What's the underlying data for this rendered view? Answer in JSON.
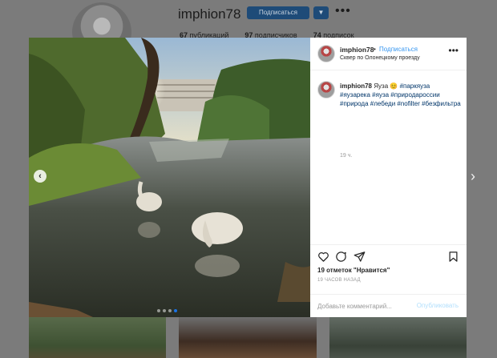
{
  "profile": {
    "username": "imphion78",
    "follow_label": "Подписаться",
    "dropdown_icon": "chevron-down-icon",
    "more_icon": "more-horizontal-icon",
    "stats": [
      {
        "count": "67",
        "label": "публикаций"
      },
      {
        "count": "97",
        "label": "подписчиков"
      },
      {
        "count": "74",
        "label": "подписок"
      }
    ]
  },
  "post": {
    "header": {
      "username": "imphion78",
      "separator": "•",
      "follow_label": "Подписаться",
      "location": "Сквер по Олонецкому проезду"
    },
    "caption": {
      "username": "imphion78",
      "text": "Яуза 😊",
      "hashtags": [
        "#паркяуза",
        "#яузарека",
        "#яуза",
        "#природароссии",
        "#природа",
        "#лебеди",
        "#nofilter",
        "#безфильтра"
      ]
    },
    "caption_time": "19 ч.",
    "likes": "19 отметок \"Нравится\"",
    "posted_ago": "19 ЧАСОВ НАЗАД",
    "comment_placeholder": "Добавьте комментарий...",
    "publish_label": "Опубликовать",
    "carousel": {
      "total": 4,
      "active_index": 3
    }
  },
  "colors": {
    "overlay": "#7b7b7b",
    "link_blue": "#3897f0",
    "button_blue": "#1e4b78",
    "publish_disabled": "#b2dffc"
  }
}
